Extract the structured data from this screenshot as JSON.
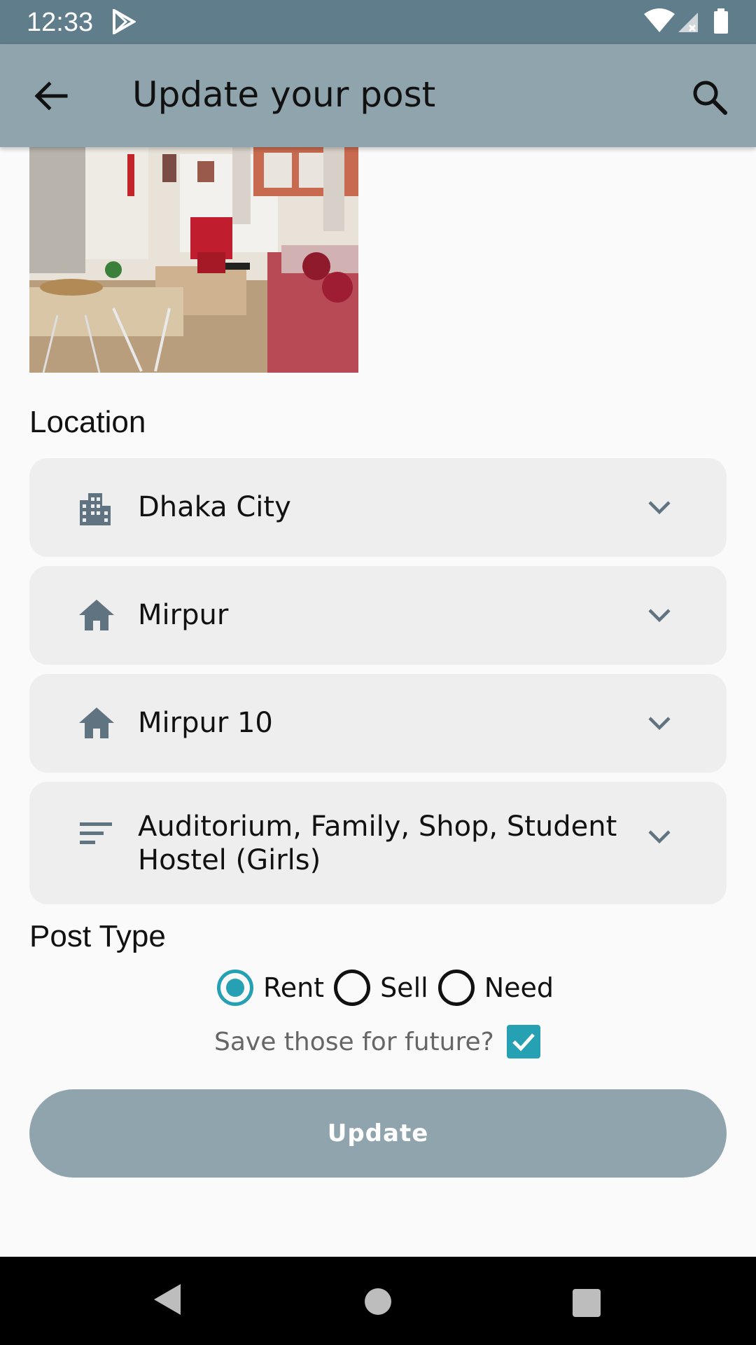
{
  "status_bar": {
    "time": "12:33"
  },
  "app_bar": {
    "title": "Update your post"
  },
  "location": {
    "label": "Location",
    "city": "Dhaka City",
    "area": "Mirpur",
    "sub_area": "Mirpur 10",
    "categories": "Auditorium, Family, Shop, Student Hostel (Girls)"
  },
  "post_type": {
    "label": "Post Type",
    "options": [
      "Rent",
      "Sell",
      "Need"
    ],
    "selected": "Rent"
  },
  "save_future": {
    "label": "Save those for future?",
    "checked": true
  },
  "update_button": {
    "label": "Update"
  },
  "colors": {
    "accent": "#26a0b3",
    "appbar": "#90a4ae",
    "statusbar": "#607d8b"
  }
}
